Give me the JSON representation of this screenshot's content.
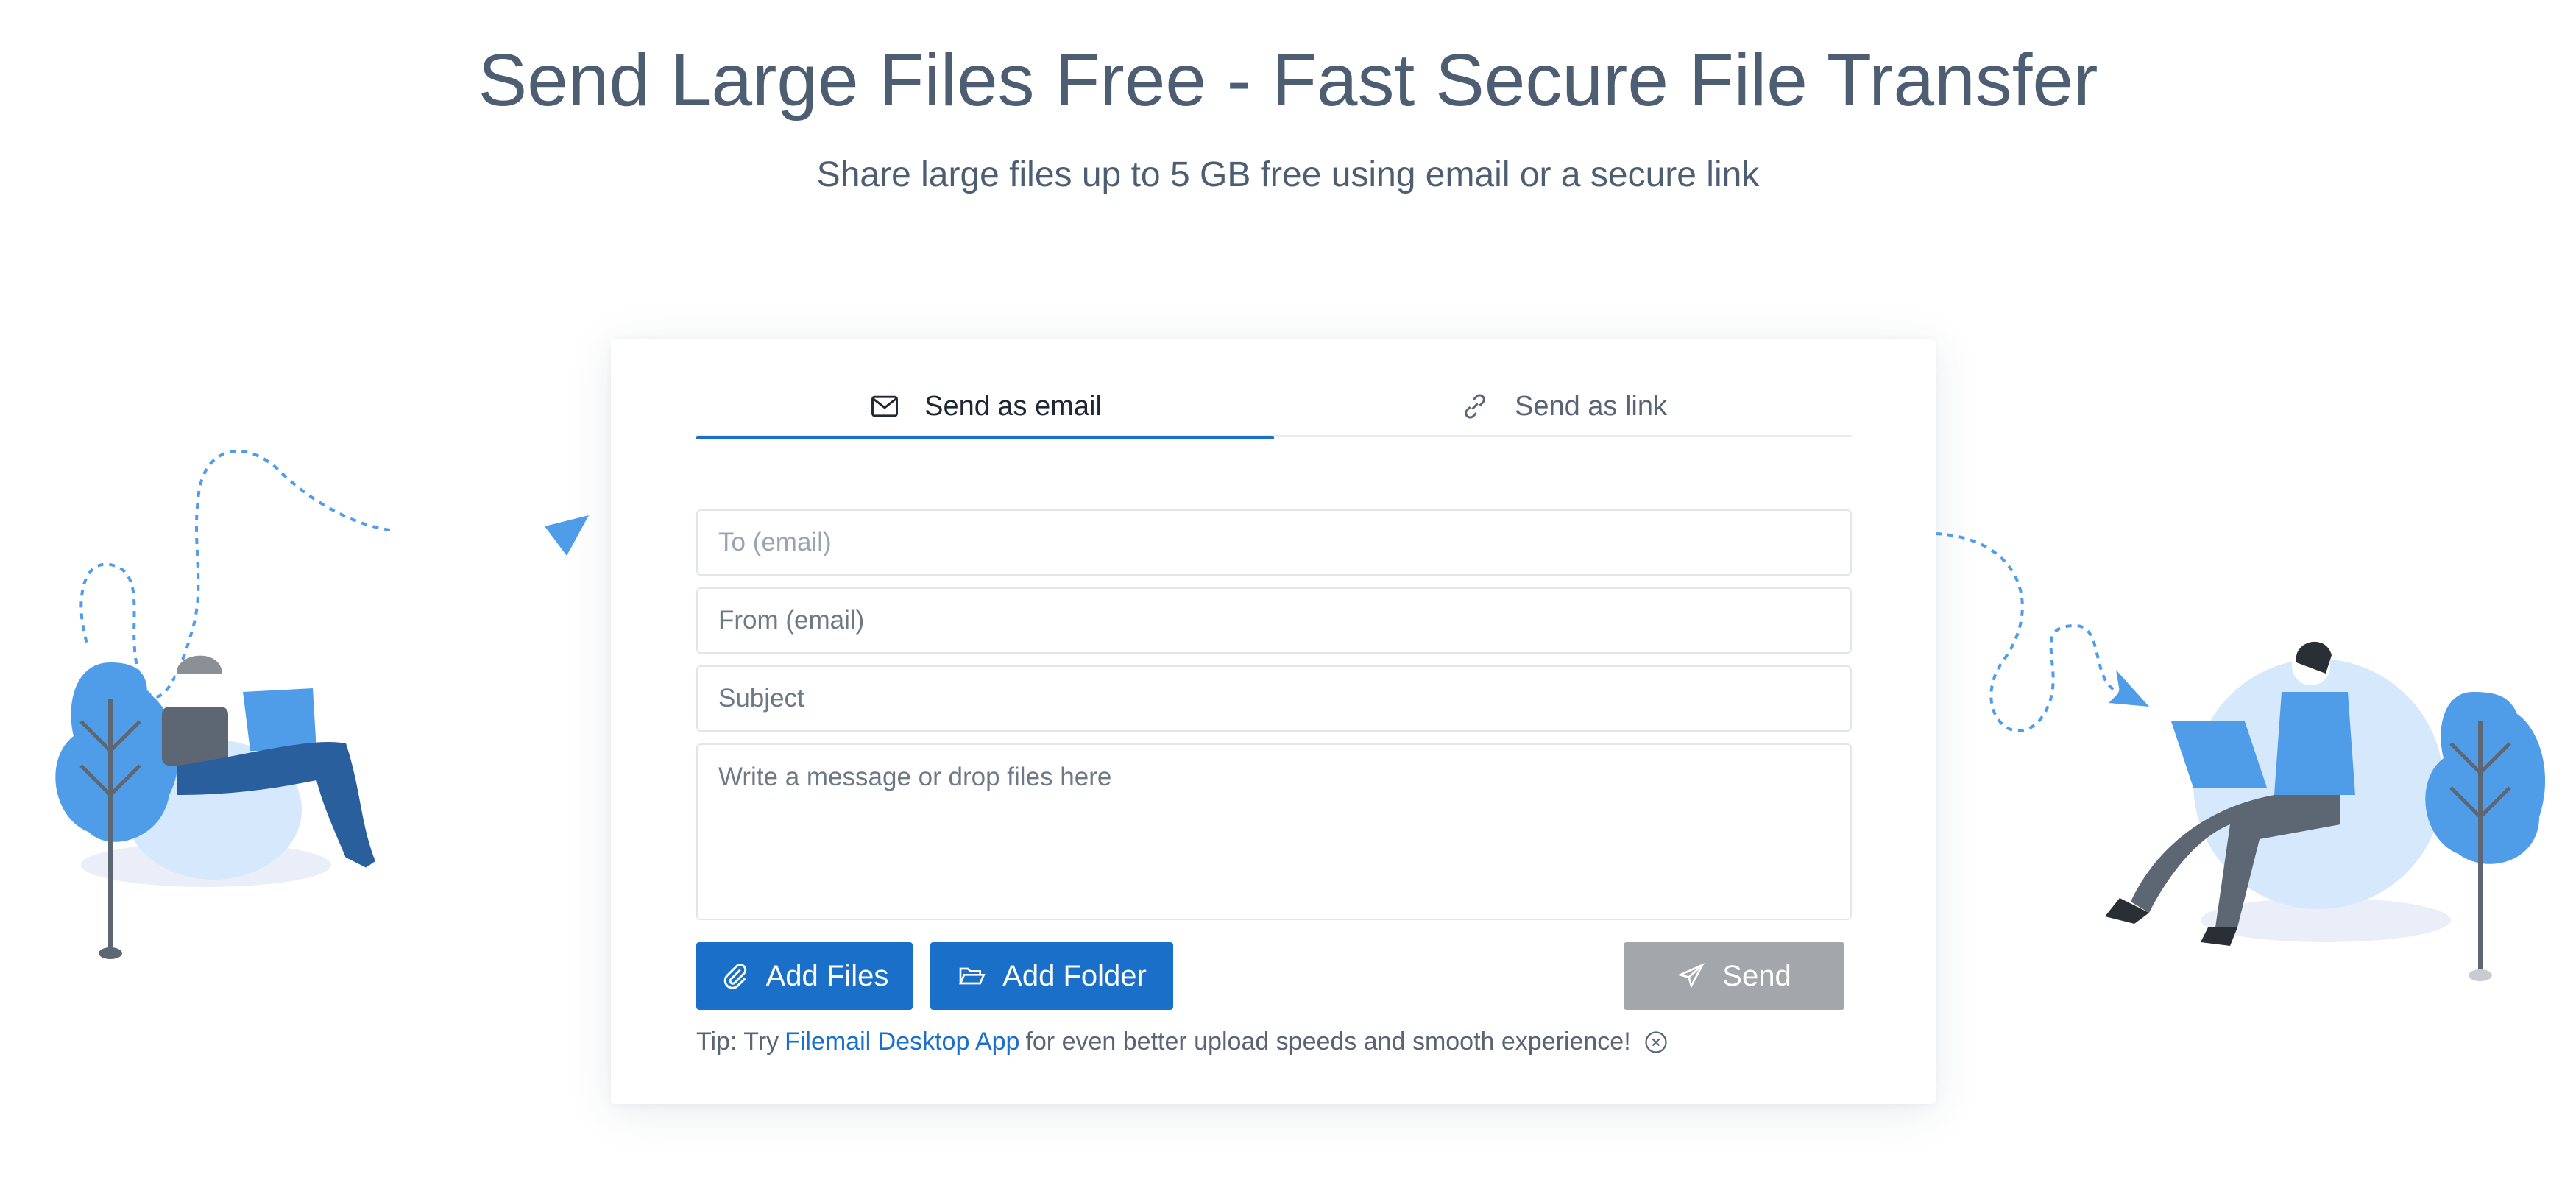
{
  "hero": {
    "title": "Send Large Files Free - Fast Secure File Transfer",
    "subtitle": "Share large files up to 5 GB free using email or a secure link"
  },
  "tabs": [
    {
      "label": "Send as email",
      "icon": "envelope-icon",
      "active": true
    },
    {
      "label": "Send as link",
      "icon": "link-icon",
      "active": false
    }
  ],
  "form": {
    "to_placeholder": "To (email)",
    "from_placeholder": "From (email)",
    "subject_placeholder": "Subject",
    "message_placeholder": "Write a message or drop files here"
  },
  "buttons": {
    "add_files": "Add Files",
    "add_folder": "Add Folder",
    "send": "Send"
  },
  "tip": {
    "prefix": "Tip: Try",
    "link": "Filemail Desktop App",
    "suffix": "for even better upload speeds and smooth experience!"
  },
  "colors": {
    "accent": "#1a6fc9",
    "send_disabled": "#a3a6ab",
    "illustration_blue": "#4f9de8",
    "title": "#4d5e73"
  }
}
